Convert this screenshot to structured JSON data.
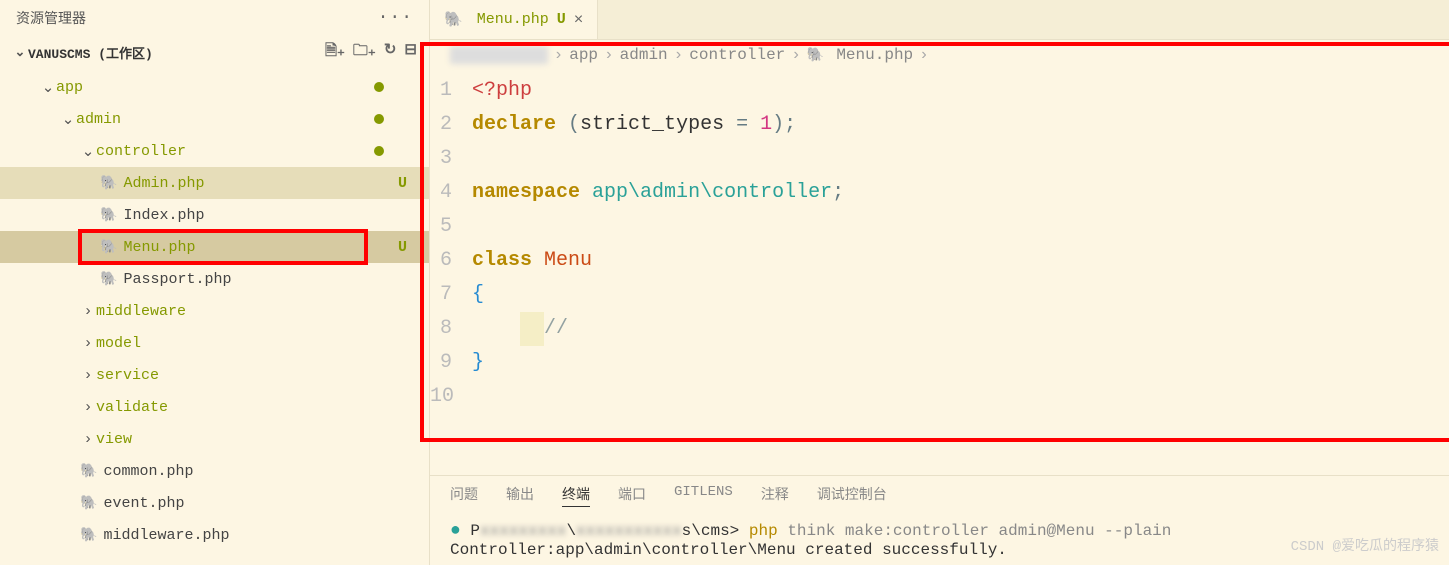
{
  "sidebar": {
    "title": "资源管理器",
    "workspace": "VANUSCMS (工作区)",
    "tree": [
      {
        "indent": 40,
        "type": "folder",
        "open": true,
        "label": "app",
        "dot": true
      },
      {
        "indent": 60,
        "type": "folder",
        "open": true,
        "label": "admin",
        "dot": true
      },
      {
        "indent": 80,
        "type": "folder",
        "open": true,
        "label": "controller",
        "dot": true
      },
      {
        "indent": 100,
        "type": "php",
        "label": "Admin.php",
        "status": "U",
        "modified": true,
        "highlighted": true
      },
      {
        "indent": 100,
        "type": "php",
        "label": "Index.php"
      },
      {
        "indent": 100,
        "type": "php",
        "label": "Menu.php",
        "status": "U",
        "modified": true,
        "selected": true,
        "redbox": true
      },
      {
        "indent": 100,
        "type": "php",
        "label": "Passport.php"
      },
      {
        "indent": 80,
        "type": "folder",
        "open": false,
        "label": "middleware"
      },
      {
        "indent": 80,
        "type": "folder",
        "open": false,
        "label": "model"
      },
      {
        "indent": 80,
        "type": "folder",
        "open": false,
        "label": "service"
      },
      {
        "indent": 80,
        "type": "folder",
        "open": false,
        "label": "validate"
      },
      {
        "indent": 80,
        "type": "folder",
        "open": false,
        "label": "view"
      },
      {
        "indent": 80,
        "type": "php",
        "label": "common.php"
      },
      {
        "indent": 80,
        "type": "php",
        "label": "event.php"
      },
      {
        "indent": 80,
        "type": "php",
        "label": "middleware.php"
      }
    ]
  },
  "tab": {
    "name": "Menu.php",
    "status": "U"
  },
  "breadcrumb": [
    "app",
    "admin",
    "controller",
    "Menu.php"
  ],
  "code": {
    "lines": 10
  },
  "terminal": {
    "tabs": [
      "问题",
      "输出",
      "终端",
      "端口",
      "GITLENS",
      "注释",
      "调试控制台"
    ],
    "active": 2,
    "cmd_prefix": "s\\cms>",
    "cmd": "php think make:controller admin@Menu --plain",
    "output": "Controller:app\\admin\\controller\\Menu created successfully."
  },
  "watermark": "CSDN @爱吃瓜的程序猿"
}
